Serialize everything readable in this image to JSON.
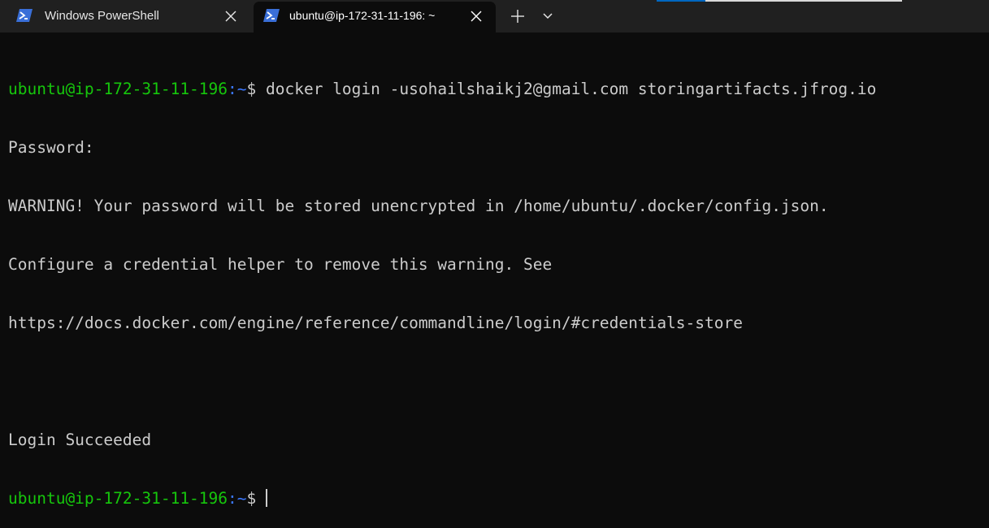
{
  "tabs": [
    {
      "title": "Windows PowerShell",
      "icon": "powershell-icon",
      "active": false
    },
    {
      "title": "ubuntu@ip-172-31-11-196: ~",
      "icon": "powershell-icon",
      "active": true
    }
  ],
  "colors": {
    "prompt_user": "#16c60c",
    "prompt_path": "#3b78ff",
    "text": "#cccccc",
    "background": "#0c0c0c"
  },
  "terminal": {
    "prompt_user": "ubuntu@ip-172-31-11-196",
    "prompt_path": ":~",
    "prompt_symbol": "$",
    "lines": [
      "docker login -usohailshaikj2@gmail.com storingartifacts.jfrog.io",
      "Password:",
      "WARNING! Your password will be stored unencrypted in /home/ubuntu/.docker/config.json.",
      "Configure a credential helper to remove this warning. See",
      "https://docs.docker.com/engine/reference/commandline/login/#credentials-store",
      "",
      "Login Succeeded"
    ]
  }
}
